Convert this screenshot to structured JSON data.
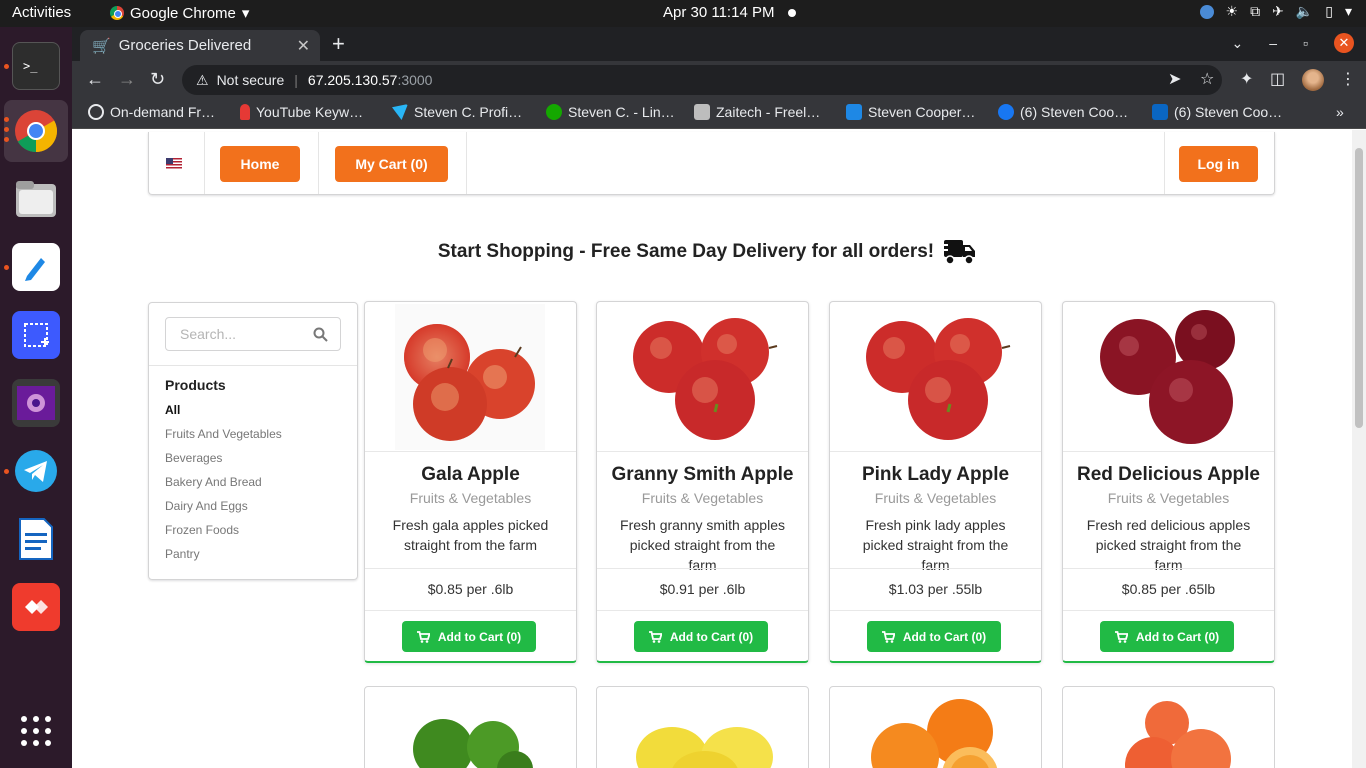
{
  "system": {
    "activities": "Activities",
    "app_name": "Google Chrome",
    "clock": "Apr 30  11:14 PM"
  },
  "browser": {
    "tab_title": "Groceries Delivered",
    "url_warning": "Not secure",
    "url_host": "67.205.130.57",
    "url_port": ":3000",
    "bookmarks": [
      {
        "label": "On-demand Fr…",
        "color": "#ffffff"
      },
      {
        "label": "YouTube Keyw…",
        "color": "#e53935"
      },
      {
        "label": "Steven C. Profi…",
        "color": "#29b6f6"
      },
      {
        "label": "Steven C. - Lin…",
        "color": "#14a800"
      },
      {
        "label": "Zaitech - Freel…",
        "color": "#dddddd"
      },
      {
        "label": "Steven Cooper…",
        "color": "#1e88e5"
      },
      {
        "label": "(6) Steven Coo…",
        "color": "#1877f2"
      },
      {
        "label": "(6) Steven Coo…",
        "color": "#0a66c2"
      }
    ]
  },
  "nav": {
    "home": "Home",
    "cart": "My Cart (0)",
    "login": "Log in"
  },
  "headline": "Start Shopping - Free Same Day Delivery for all orders!",
  "sidebar": {
    "search_placeholder": "Search...",
    "title": "Products",
    "categories": [
      "All",
      "Fruits And Vegetables",
      "Beverages",
      "Bakery And Bread",
      "Dairy And Eggs",
      "Frozen Foods",
      "Pantry"
    ]
  },
  "products": [
    {
      "name": "Gala Apple",
      "category": "Fruits & Vegetables",
      "desc": "Fresh gala apples picked straight from the farm",
      "price": "$0.85 per .6lb",
      "button": "Add to Cart (0)"
    },
    {
      "name": "Granny Smith Apple",
      "category": "Fruits & Vegetables",
      "desc": "Fresh granny smith apples picked straight from the farm",
      "price": "$0.91 per .6lb",
      "button": "Add to Cart (0)"
    },
    {
      "name": "Pink Lady Apple",
      "category": "Fruits & Vegetables",
      "desc": "Fresh pink lady apples picked straight from the farm",
      "price": "$1.03 per .55lb",
      "button": "Add to Cart (0)"
    },
    {
      "name": "Red Delicious Apple",
      "category": "Fruits & Vegetables",
      "desc": "Fresh red delicious apples picked straight from the farm",
      "price": "$0.85 per .65lb",
      "button": "Add to Cart (0)"
    }
  ],
  "colors": {
    "accent_orange": "#f2711c",
    "accent_green": "#21ba45"
  },
  "icons": {
    "truck": "delivery-truck-icon",
    "search": "search-icon",
    "cart": "shopping-cart-icon"
  }
}
